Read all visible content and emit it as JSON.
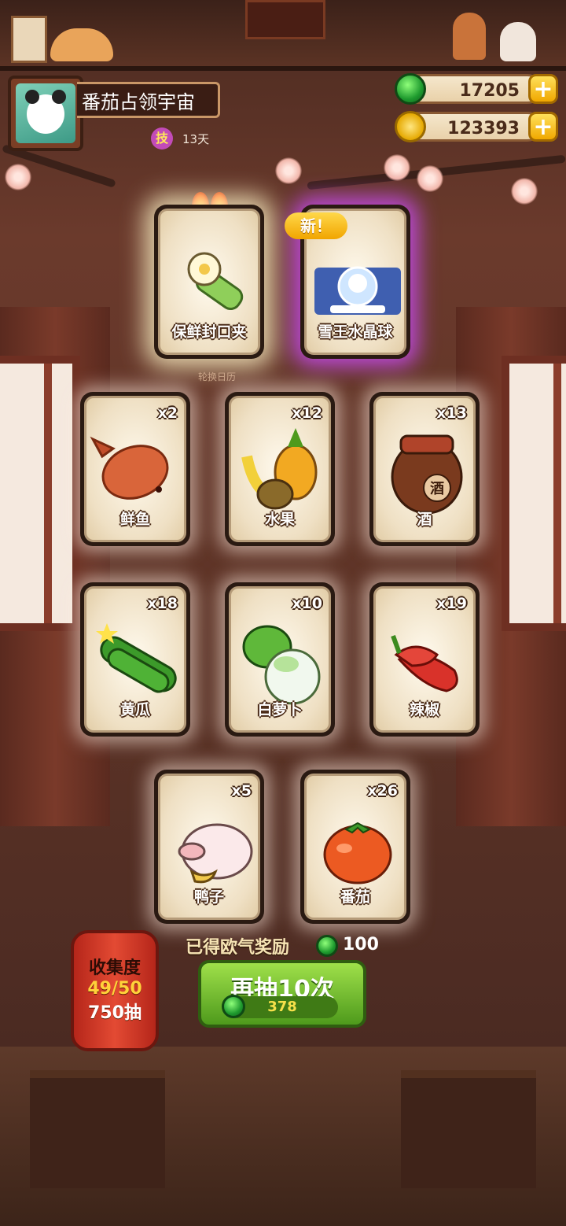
{
  "profile": {
    "name": "番茄占领宇宙",
    "skill_badge": "技",
    "days": "13天"
  },
  "currency": {
    "jade": "17205",
    "coins": "123393",
    "add_symbol": "+"
  },
  "featured_cards": [
    {
      "label": "保鲜封口夹",
      "art": "sealing-clip-icon"
    },
    {
      "label": "雪王水晶球",
      "art": "snow-globe-icon",
      "badge": "新！"
    }
  ],
  "calendar_label": "轮换日历",
  "cards": [
    {
      "label": "鲜鱼",
      "count": "x2",
      "art": "fish-icon"
    },
    {
      "label": "水果",
      "count": "x12",
      "art": "fruit-icon"
    },
    {
      "label": "酒",
      "count": "x13",
      "art": "wine-jar-icon",
      "jar_text": "酒"
    },
    {
      "label": "黄瓜",
      "count": "x18",
      "art": "cucumber-icon"
    },
    {
      "label": "白萝卜",
      "count": "x10",
      "art": "radish-icon"
    },
    {
      "label": "辣椒",
      "count": "x19",
      "art": "chili-icon"
    },
    {
      "label": "鸭子",
      "count": "x5",
      "art": "duck-icon"
    },
    {
      "label": "番茄",
      "count": "x26",
      "art": "tomato-icon"
    }
  ],
  "lucky_reward": {
    "text": "已得欧气奖励",
    "value": "100"
  },
  "draw_button": {
    "label": "再抽10次",
    "cost": "378"
  },
  "collection": {
    "title": "收集度",
    "progress": "49/50",
    "draws": "750抽"
  },
  "colors": {
    "jade": "#1e9a2e",
    "gold": "#f0a800",
    "button_green": "#4e9a1c",
    "lantern_red": "#e34a33"
  }
}
